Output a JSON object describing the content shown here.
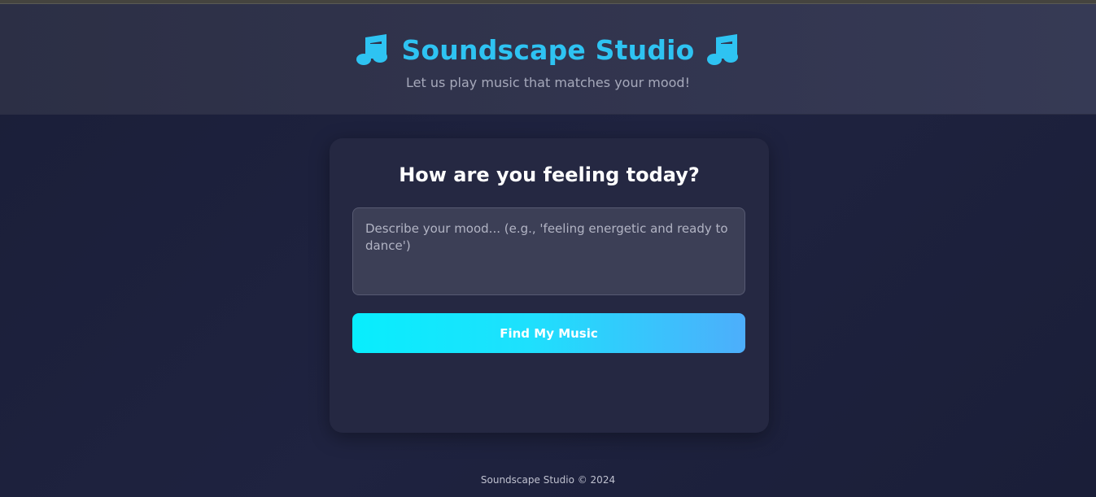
{
  "header": {
    "title": "Soundscape Studio",
    "subtitle": "Let us play music that matches your mood!",
    "left_icon": "music-note-icon",
    "right_icon": "music-note-icon",
    "accent_color": "#2ec3f2"
  },
  "mood_card": {
    "heading": "How are you feeling today?",
    "input": {
      "placeholder": "Describe your mood... (e.g., 'feeling energetic and ready to dance')",
      "value": ""
    },
    "button_label": "Find My Music"
  },
  "footer": {
    "text": "Soundscape Studio © 2024"
  }
}
